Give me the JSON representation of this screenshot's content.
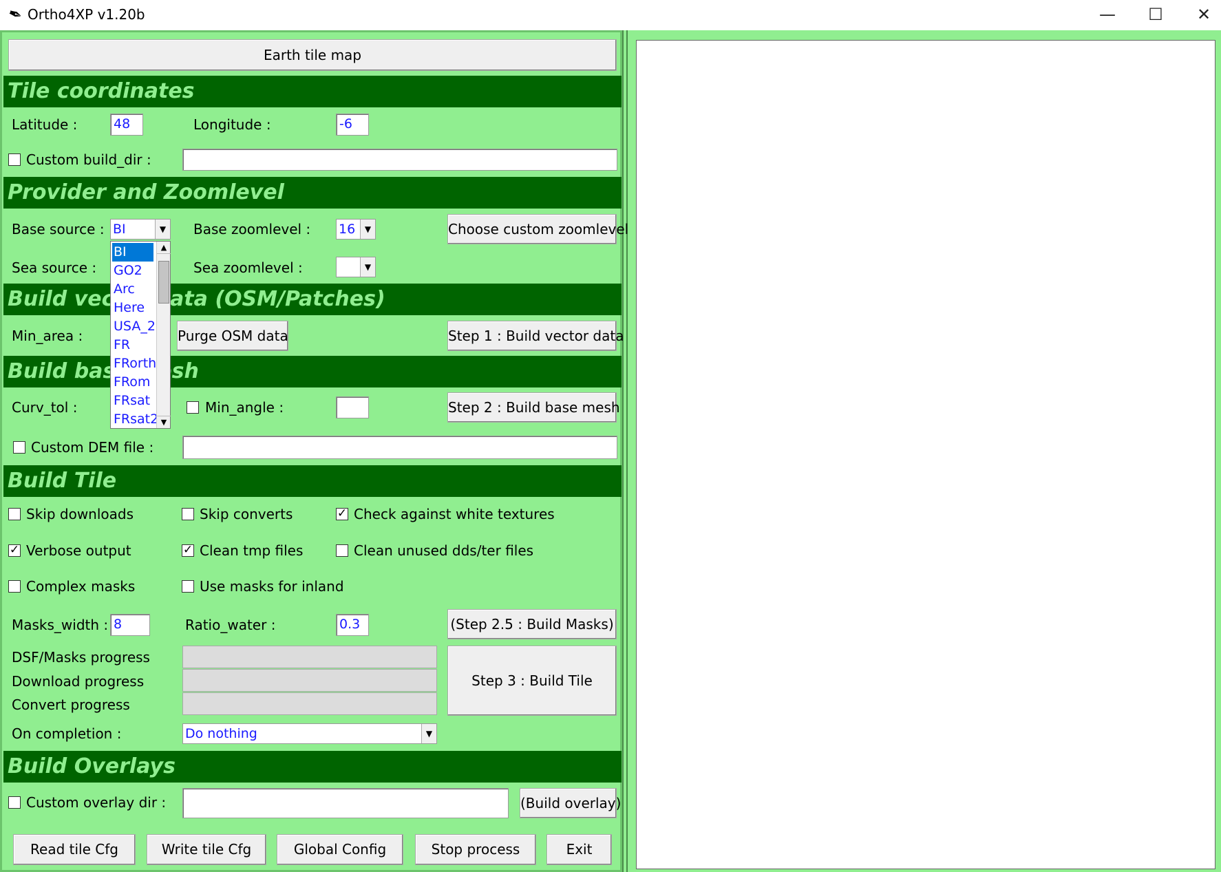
{
  "window": {
    "title": "Ortho4XP  v1.20b",
    "minimize": "—",
    "maximize": "☐",
    "close": "✕"
  },
  "earth_tile_map": "Earth tile map",
  "sections": {
    "tile_coordinates": "Tile coordinates",
    "provider": "Provider and Zoomlevel",
    "vector": "Build vector data (OSM/Patches)",
    "base_mesh": "Build base mesh",
    "build_tile": "Build Tile",
    "overlays": "Build Overlays"
  },
  "tile": {
    "latitude_label": "Latitude  :",
    "latitude": "48",
    "longitude_label": "Longitude  :",
    "longitude": "-6",
    "custom_build_dir_label": "Custom build_dir  :",
    "custom_build_dir": ""
  },
  "provider": {
    "base_source_label": "Base source  :",
    "base_source": "BI",
    "base_zoom_label": "Base zoomlevel  :",
    "base_zoom": "16",
    "custom_zoom_button": "Choose custom zoomlevel",
    "sea_source_label": "Sea source  :",
    "sea_zoom_label": "Sea zoomlevel  :",
    "sea_zoom": ""
  },
  "dropdown": {
    "options": [
      "BI",
      "GO2",
      "Arc",
      "Here",
      "USA_2",
      "FR",
      "FRorth",
      "FRom",
      "FRsat",
      "FRsat2"
    ],
    "selected": "BI"
  },
  "vector": {
    "min_area_label": "Min_area  :",
    "purge_button": "Purge OSM data",
    "step1_button": "Step 1 : Build vector data"
  },
  "mesh": {
    "curv_tol_label": "Curv_tol  :",
    "min_angle_label": "Min_angle :",
    "min_angle": "",
    "step2_button": "Step 2 : Build base mesh",
    "custom_dem_label": "Custom DEM file :",
    "custom_dem": ""
  },
  "build": {
    "skip_downloads": "Skip downloads",
    "skip_converts": "Skip converts",
    "check_white": "Check against white textures",
    "verbose": "Verbose output",
    "clean_tmp": "Clean tmp files",
    "clean_unused": "Clean unused dds/ter files",
    "complex_masks": "Complex masks",
    "masks_inland": "Use masks for inland",
    "masks_width_label": "Masks_width :",
    "masks_width": "8",
    "ratio_water_label": "Ratio_water :",
    "ratio_water": "0.3",
    "step25_button": "(Step 2.5 : Build Masks)",
    "dsf_progress_label": "DSF/Masks progress",
    "download_progress_label": "Download progress",
    "convert_progress_label": "Convert progress",
    "step3_button": "Step 3 : Build Tile",
    "on_completion_label": "On completion :",
    "on_completion": "Do nothing",
    "checks": {
      "skip_downloads": false,
      "skip_converts": false,
      "check_white": true,
      "verbose": true,
      "clean_tmp": true,
      "clean_unused": false,
      "complex_masks": false,
      "masks_inland": false
    }
  },
  "overlay": {
    "custom_dir_label": "Custom overlay dir :",
    "custom_dir": "",
    "build_button": "(Build overlay)"
  },
  "footer": {
    "read_cfg": "Read tile Cfg",
    "write_cfg": "Write tile Cfg",
    "global_config": "Global Config",
    "stop": "Stop process",
    "exit": "Exit"
  },
  "colors": {
    "panel": "#90ee90",
    "header_bg": "#006400",
    "header_text": "#90ee90",
    "entry_text": "#1a1aff",
    "selection": "#0078d7"
  }
}
